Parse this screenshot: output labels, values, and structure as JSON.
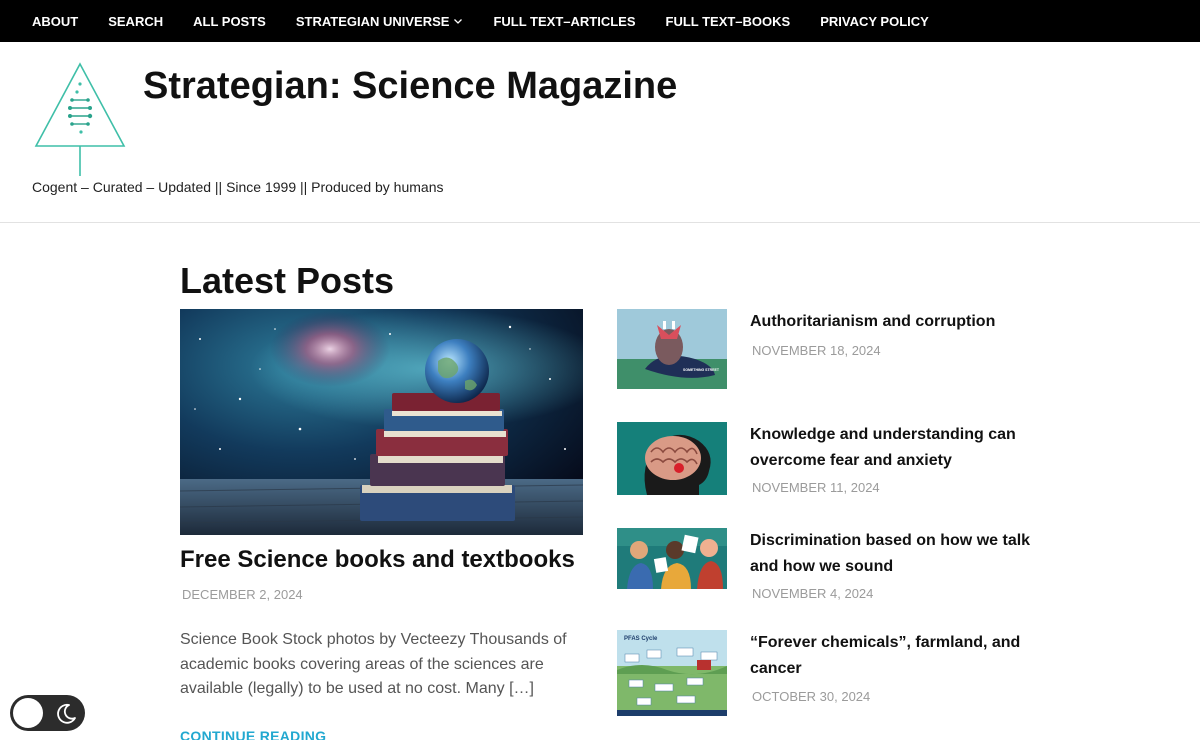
{
  "nav": {
    "items": [
      "About",
      "Search",
      "All Posts",
      "Strategian Universe",
      "Full Text–Articles",
      "Full Text–Books",
      "Privacy Policy"
    ]
  },
  "header": {
    "title": "Strategian: Science Magazine",
    "tagline": "Cogent – Curated – Updated || Since 1999 || Produced by humans"
  },
  "main": {
    "heading": "Latest Posts",
    "featured": {
      "title": "Free Science books and textbooks",
      "date": "December 2, 2024",
      "excerpt": "Science Book Stock photos by Vecteezy Thousands of academic books covering areas of the sciences are available (legally) to be used at no cost. Many […]",
      "continue": "Continue Reading"
    },
    "posts": [
      {
        "title": "Authoritarianism and corruption",
        "date": "November 18, 2024"
      },
      {
        "title": "Knowledge and understanding can overcome fear and anxiety",
        "date": "November 11, 2024"
      },
      {
        "title": "Discrimination based on how we talk and how we sound",
        "date": "November 4, 2024"
      },
      {
        "title": "“Forever chemicals”, farmland, and cancer",
        "date": "October 30, 2024"
      }
    ]
  },
  "thumbnail_text": {
    "shoe_label": "SOMETHING STREET",
    "pfas_label": "PFAS Cycle"
  },
  "colors": {
    "nav_bg": "#000000",
    "accent_link": "#22a8d0",
    "date_gray": "#9b9b9b",
    "logo_teal": "#3fbfa8"
  },
  "toggle": {
    "icon": "moon-icon"
  }
}
